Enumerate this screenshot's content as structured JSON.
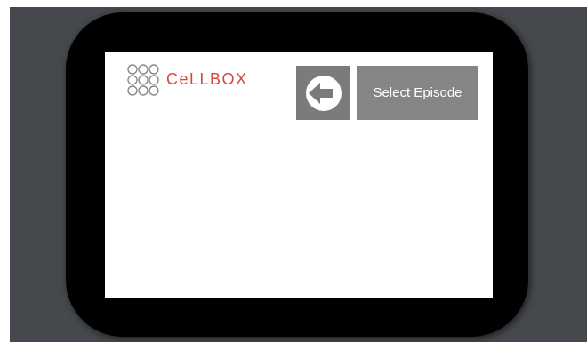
{
  "app": {
    "brand_name": "CeLLBOX",
    "logo_icon": "cellbox-logo-icon",
    "brand_color": "#d9463f"
  },
  "toolbar": {
    "back_icon": "back-arrow-icon",
    "select_episode_label": "Select Episode"
  },
  "colors": {
    "background": "#45484c",
    "device_frame": "#000000",
    "screen": "#ffffff",
    "button": "#7b7b7b"
  }
}
